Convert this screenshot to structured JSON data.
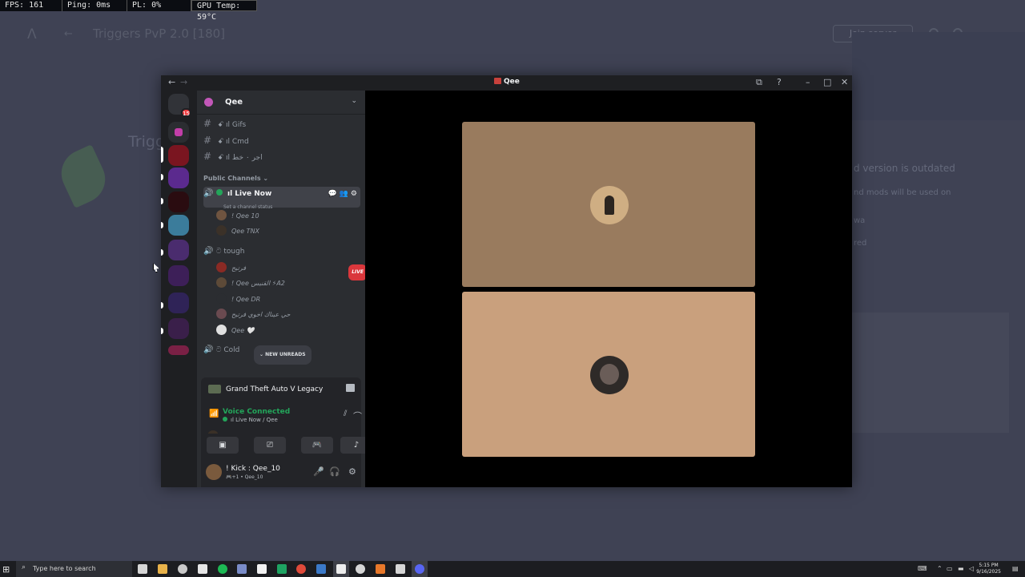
{
  "overlay": {
    "fps": "FPS: 161",
    "ping": "Ping: 0ms",
    "pl": "PL: 0%",
    "gpu": "GPU Temp: 59°C"
  },
  "background": {
    "title": "Triggers PvP 2.0 [180]",
    "button": "Join server",
    "trig": "Trigg",
    "texts": [
      "d version is outdated",
      "nd mods will be used on",
      "wa",
      "red"
    ]
  },
  "window": {
    "title": "Qee",
    "server": {
      "name": "Qee",
      "badge": "15"
    },
    "channels": [
      {
        "name": "ꗃ ıl Gifs"
      },
      {
        "name": "ꗃ ıl Cmd"
      },
      {
        "name": "ꗃ ıl اجر ٠ خط"
      }
    ],
    "category": "Public Channels",
    "live_channel": {
      "name": "ıl Live Now",
      "status": "Set a channel status"
    },
    "live_users": [
      "! Qee 10",
      "Qee TNX"
    ],
    "tough": {
      "name": "ට tough",
      "live_label": "LIVE"
    },
    "tough_users": [
      "فرتيح",
      "! Qee القنيس ⚡A2",
      "! Qee DR",
      "حي عيناك اخوي فرتيح",
      "Qee 🤍"
    ],
    "cold": {
      "name": "ට Cold",
      "new_unreads": "NEW UNREADS"
    },
    "activity": {
      "game": "Grand Theft Auto V Legacy"
    },
    "voice": {
      "status": "Voice Connected",
      "location": "ıl Live Now / Qee"
    },
    "user": {
      "name": "! Kick : Qee_10",
      "sub": "🎮+1 • Qee_10"
    }
  },
  "taskbar": {
    "search_placeholder": "Type here to search",
    "time": "5:15 PM",
    "date": "9/16/2025"
  },
  "colors": {
    "accent_green": "#23a55a",
    "live_red": "#da373c",
    "tile_top": "#997b5e",
    "tile_bottom": "#c9a07d"
  }
}
